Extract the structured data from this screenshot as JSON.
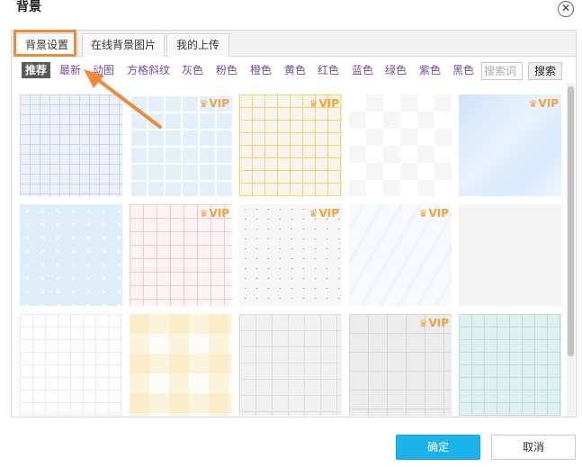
{
  "dialog": {
    "title": "背景",
    "close_icon": "close-icon"
  },
  "tabs": [
    {
      "label": "背景设置",
      "active": true
    },
    {
      "label": "在线背景图片",
      "active": false
    },
    {
      "label": "我的上传",
      "active": false
    }
  ],
  "categories": [
    {
      "label": "推荐",
      "active": true
    },
    {
      "label": "最新",
      "active": false
    },
    {
      "label": "动图",
      "active": false
    },
    {
      "label": "方格斜纹",
      "active": false
    },
    {
      "label": "灰色",
      "active": false
    },
    {
      "label": "粉色",
      "active": false
    },
    {
      "label": "橙色",
      "active": false
    },
    {
      "label": "黄色",
      "active": false
    },
    {
      "label": "红色",
      "active": false
    },
    {
      "label": "蓝色",
      "active": false
    },
    {
      "label": "绿色",
      "active": false
    },
    {
      "label": "紫色",
      "active": false
    },
    {
      "label": "黑色",
      "active": false
    }
  ],
  "search": {
    "placeholder": "搜索词",
    "button_label": "搜索"
  },
  "tiles": [
    {
      "pattern": "grid-fine",
      "vip": false
    },
    {
      "pattern": "grid-blue",
      "vip": true
    },
    {
      "pattern": "grid-yellow",
      "vip": true
    },
    {
      "pattern": "checker-white",
      "vip": false
    },
    {
      "pattern": "sky",
      "vip": true
    },
    {
      "pattern": "dots-blue",
      "vip": false
    },
    {
      "pattern": "grid-pink",
      "vip": true
    },
    {
      "pattern": "speckle",
      "vip": true
    },
    {
      "pattern": "swirl",
      "vip": true
    },
    {
      "pattern": "plain-grey",
      "vip": false
    },
    {
      "pattern": "grid-white",
      "vip": false
    },
    {
      "pattern": "plaid",
      "vip": false
    },
    {
      "pattern": "grid-grey",
      "vip": false
    },
    {
      "pattern": "dashed2",
      "vip": true
    },
    {
      "pattern": "grid-teal",
      "vip": false
    }
  ],
  "vip_label": "VIP",
  "vip_color": "#f2a33a",
  "highlight_color": "#f08a3a",
  "buttons": {
    "ok_label": "确定",
    "cancel_label": "取消"
  },
  "accent_color": "#1cb2ea"
}
